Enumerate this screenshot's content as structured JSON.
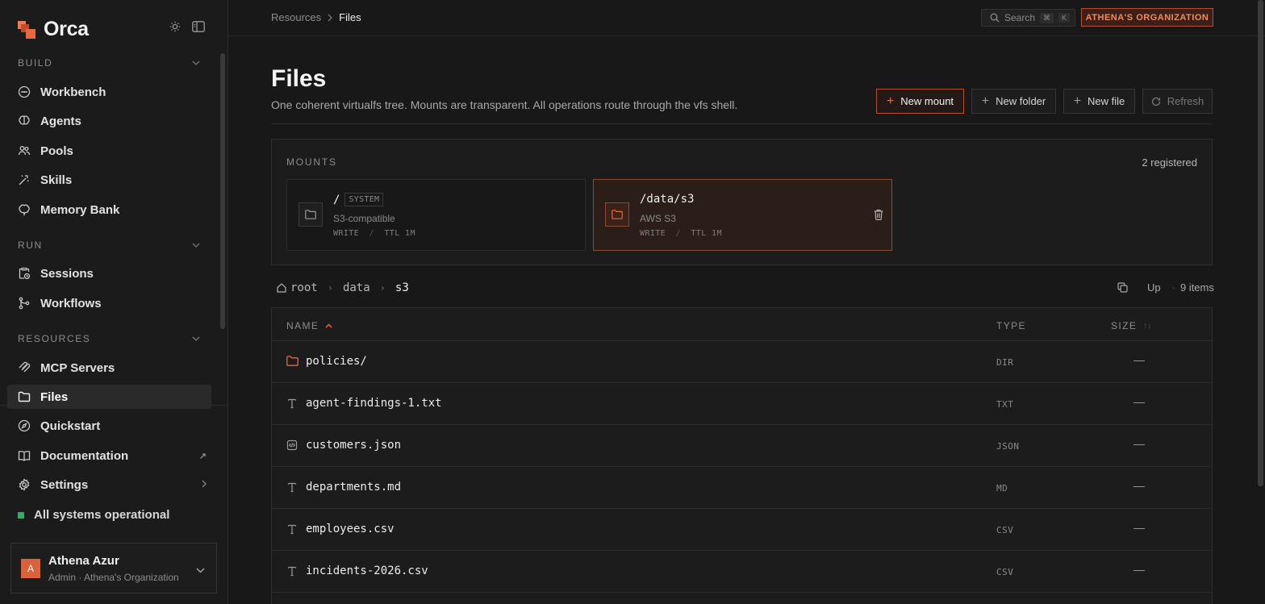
{
  "app": {
    "name": "Orca"
  },
  "sidebar": {
    "sections": [
      {
        "label": "BUILD",
        "items": [
          "Workbench",
          "Agents",
          "Pools",
          "Skills",
          "Memory Bank"
        ]
      },
      {
        "label": "RUN",
        "items": [
          "Sessions",
          "Workflows"
        ]
      },
      {
        "label": "RESOURCES",
        "items": [
          "MCP Servers",
          "Files"
        ]
      }
    ],
    "active": "Files",
    "footer_items": [
      "Quickstart",
      "Documentation",
      "Settings"
    ],
    "status": "All systems operational",
    "user": {
      "initial": "A",
      "name": "Athena Azur",
      "role": "Admin · Athena's Organization"
    }
  },
  "topbar": {
    "breadcrumb": [
      "Resources",
      "Files"
    ],
    "search_label": "Search",
    "search_keys": [
      "⌘",
      "K"
    ],
    "org_badge": "ATHENA'S ORGANIZATION"
  },
  "page": {
    "title": "Files",
    "subtitle": "One coherent virtualfs tree. Mounts are transparent. All operations route through the vfs shell.",
    "actions": [
      "New mount",
      "New folder",
      "New file",
      "Refresh"
    ]
  },
  "mounts": {
    "heading": "MOUNTS",
    "count_label": "2 registered",
    "items": [
      {
        "path": "/",
        "tag": "SYSTEM",
        "kind": "S3-compatible",
        "mode": "WRITE",
        "ttl": "TTL 1M"
      },
      {
        "path": "/data/s3",
        "tag": "",
        "kind": "AWS S3",
        "mode": "WRITE",
        "ttl": "TTL 1M"
      }
    ]
  },
  "browser": {
    "path": [
      "root",
      "data",
      "s3"
    ],
    "up_label": "Up",
    "item_count": "9 items",
    "columns": {
      "name": "NAME",
      "type": "TYPE",
      "size": "SIZE"
    },
    "rows": [
      {
        "name": "policies/",
        "type": "DIR",
        "size": "—",
        "icon": "folder-icon"
      },
      {
        "name": "agent-findings-1.txt",
        "type": "TXT",
        "size": "—",
        "icon": "text-file-icon"
      },
      {
        "name": "customers.json",
        "type": "JSON",
        "size": "—",
        "icon": "code-file-icon"
      },
      {
        "name": "departments.md",
        "type": "MD",
        "size": "—",
        "icon": "text-file-icon"
      },
      {
        "name": "employees.csv",
        "type": "CSV",
        "size": "—",
        "icon": "text-file-icon"
      },
      {
        "name": "incidents-2026.csv",
        "type": "CSV",
        "size": "—",
        "icon": "text-file-icon"
      }
    ]
  },
  "colors": {
    "accent": "#e8683f",
    "status_ok": "#3aa86a",
    "background": "#181818"
  }
}
